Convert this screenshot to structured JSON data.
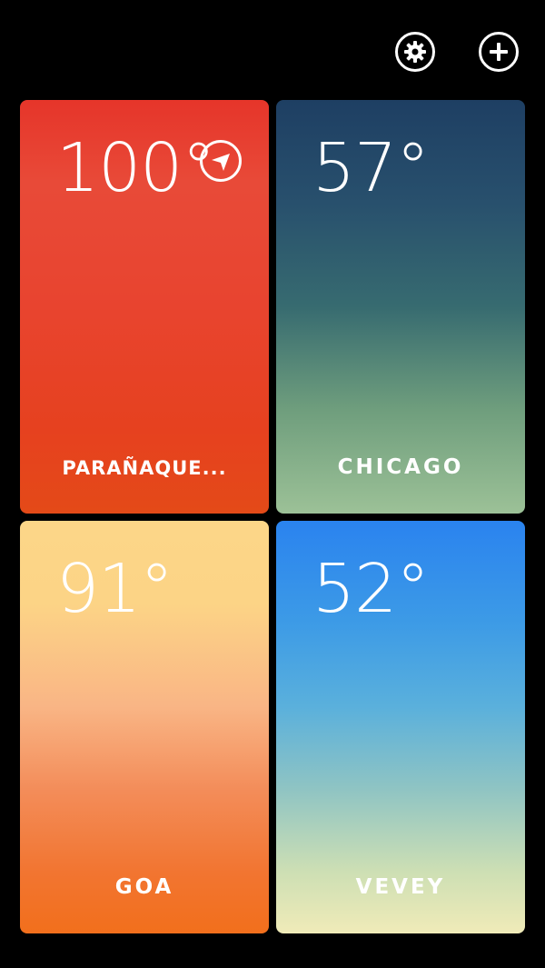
{
  "header": {
    "settings_icon": "gear-icon",
    "add_icon": "plus-icon"
  },
  "cities": [
    {
      "name": "PARAÑAQUE...",
      "temp": "100°",
      "current_location": true,
      "colors": [
        "#e6352a",
        "#e44a18"
      ]
    },
    {
      "name": "CHICAGO",
      "temp": "57°",
      "current_location": false,
      "colors": [
        "#1e3f63",
        "#9cc197"
      ]
    },
    {
      "name": "GOA",
      "temp": "91°",
      "current_location": false,
      "colors": [
        "#fcd688",
        "#f26f1c"
      ]
    },
    {
      "name": "VEVEY",
      "temp": "52°",
      "current_location": false,
      "colors": [
        "#2a83ef",
        "#f0ebb8"
      ]
    }
  ]
}
